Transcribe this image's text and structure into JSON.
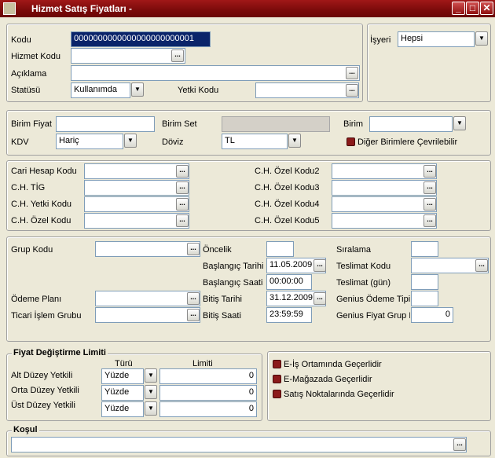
{
  "window": {
    "title": "Hizmet Satış Fiyatları -",
    "minimize": "_",
    "maximize": "□",
    "close": "✕"
  },
  "general": {
    "kodu_label": "Kodu",
    "kodu_value": "0000000000000000000000001",
    "hizmet_kodu_label": "Hizmet Kodu",
    "hizmet_kodu_value": "",
    "aciklama_label": "Açıklama",
    "aciklama_value": "",
    "statusu_label": "Statüsü",
    "statusu_value": "Kullanımda",
    "yetki_kodu_label": "Yetki Kodu",
    "yetki_kodu_value": "",
    "isyeri_label": "İşyeri",
    "isyeri_value": "Hepsi"
  },
  "price": {
    "birim_fiyat_label": "Birim Fiyat",
    "birim_fiyat_value": "",
    "birim_set_label": "Birim Set",
    "birim_set_value": "",
    "birim_label": "Birim",
    "birim_value": "",
    "kdv_label": "KDV",
    "kdv_value": "Hariç",
    "doviz_label": "Döviz",
    "doviz_value": "TL",
    "diger_birimler_label": "Diğer Birimlere Çevrilebilir"
  },
  "cari": {
    "cari_hesap_kodu_label": "Cari Hesap Kodu",
    "ch_tig_label": "C.H. TİG",
    "ch_yetki_kodu_label": "C.H. Yetki Kodu",
    "ch_ozel_kodu_label": "C.H. Özel Kodu",
    "ch_ozel_kodu2_label": "C.H. Özel Kodu2",
    "ch_ozel_kodu3_label": "C.H. Özel Kodu3",
    "ch_ozel_kodu4_label": "C.H. Özel Kodu4",
    "ch_ozel_kodu5_label": "C.H. Özel Kodu5"
  },
  "details": {
    "grup_kodu_label": "Grup Kodu",
    "odeme_plani_label": "Ödeme Planı",
    "ticari_islem_grubu_label": "Ticari İşlem Grubu",
    "oncelik_label": "Öncelik",
    "oncelik_value": "",
    "baslangic_tarihi_label": "Başlangıç Tarihi",
    "baslangic_tarihi_value": "11.05.2009",
    "baslangic_saati_label": "Başlangıç Saati",
    "baslangic_saati_value": "00:00:00",
    "bitis_tarihi_label": "Bitiş Tarihi",
    "bitis_tarihi_value": "31.12.2009",
    "bitis_saati_label": "Bitiş Saati",
    "bitis_saati_value": "23:59:59",
    "siralama_label": "Sıralama",
    "siralama_value": "",
    "teslimat_kodu_label": "Teslimat Kodu",
    "teslimat_kodu_value": "",
    "teslimat_gun_label": "Teslimat (gün)",
    "teslimat_gun_value": "",
    "genius_odeme_tipi_label": "Genius Ödeme Tipi",
    "genius_odeme_tipi_value": "",
    "genius_fiyat_grup_label": "Genius Fiyat Grup N",
    "genius_fiyat_grup_value": "0"
  },
  "limits": {
    "title": "Fiyat Değiştirme Limiti",
    "turu_header": "Türü",
    "limiti_header": "Limiti",
    "rows": [
      {
        "label": "Alt Düzey Yetkili",
        "turu": "Yüzde",
        "limit": "0"
      },
      {
        "label": "Orta Düzey Yetkili",
        "turu": "Yüzde",
        "limit": "0"
      },
      {
        "label": "Üst Düzey Yetkili",
        "turu": "Yüzde",
        "limit": "0"
      }
    ]
  },
  "options": {
    "eis": "E-İş Ortamında Geçerlidir",
    "emagaza": "E-Mağazada Geçerlidir",
    "satis_noktalari": "Satış Noktalarında Geçerlidir"
  },
  "kosul": {
    "title": "Koşul",
    "value": ""
  },
  "glyphs": {
    "ellipsis": "...",
    "dropdown": "▼"
  },
  "colors": {
    "titlebar": "#8b0e0e",
    "form_bg": "#ece9d8",
    "checkbox": "#8b1a1a",
    "selection": "#0a246a"
  }
}
